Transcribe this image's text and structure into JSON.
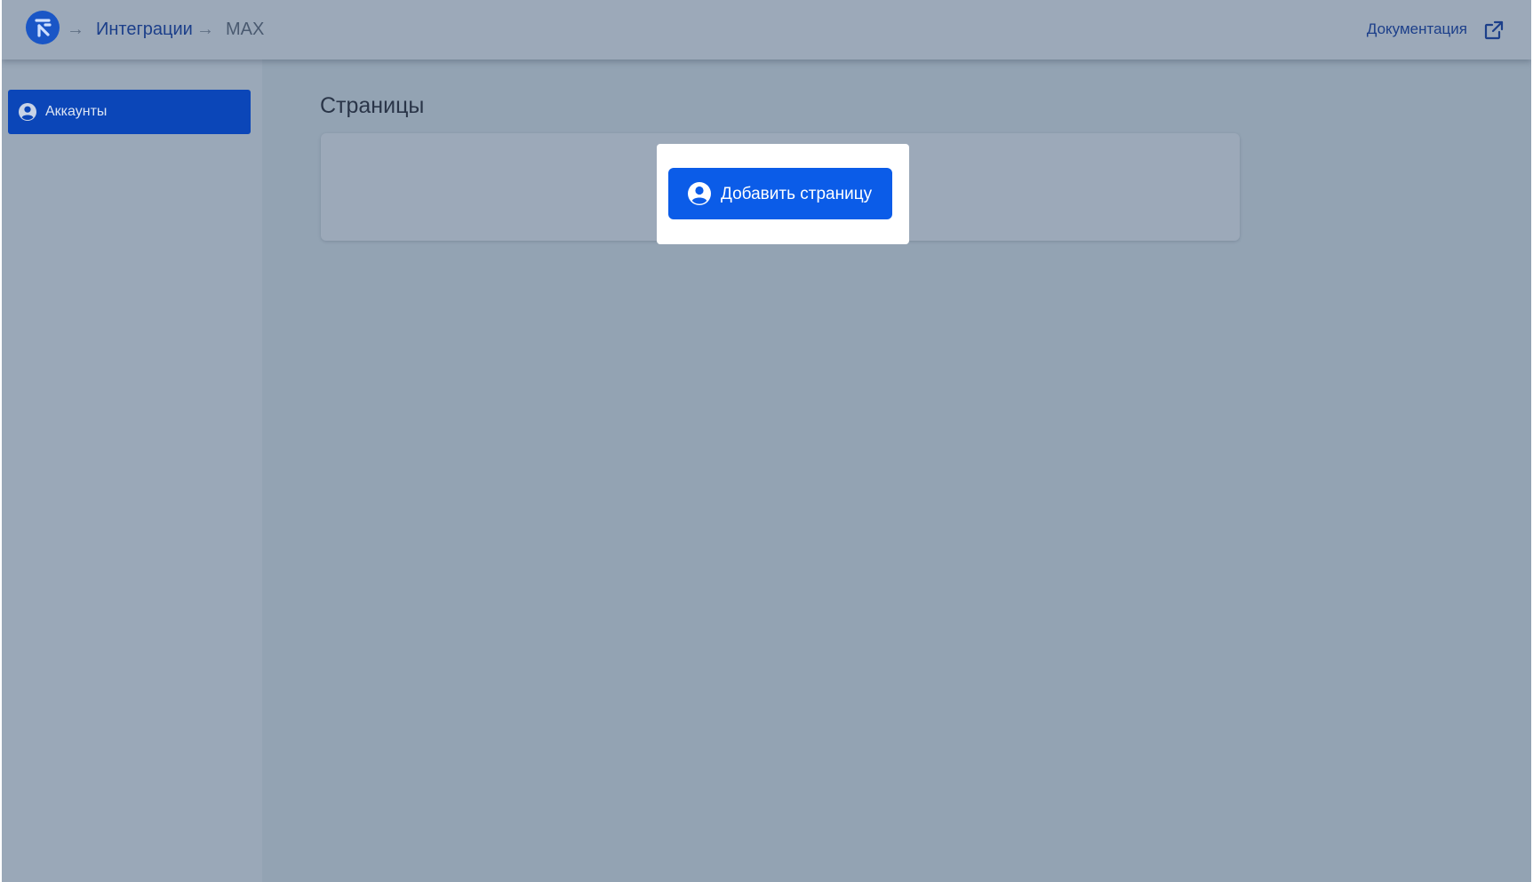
{
  "header": {
    "breadcrumb": [
      {
        "label": "Интеграции"
      },
      {
        "label": "MAX"
      }
    ],
    "breadcrumb_separator": "→",
    "doc_link_label": "Документация",
    "logo_icon": "logo-icon",
    "external_icon": "external-link-icon"
  },
  "sidebar": {
    "items": [
      {
        "label": "Аккаунты",
        "icon": "user-circle-icon",
        "active": true
      }
    ]
  },
  "main": {
    "title": "Страницы",
    "add_button": {
      "label": "Добавить страницу",
      "icon": "user-circle-icon"
    }
  },
  "colors": {
    "accent": "#0b5ce8",
    "sidebar_active": "#0b46b8",
    "overlay": "#93a3b3"
  }
}
